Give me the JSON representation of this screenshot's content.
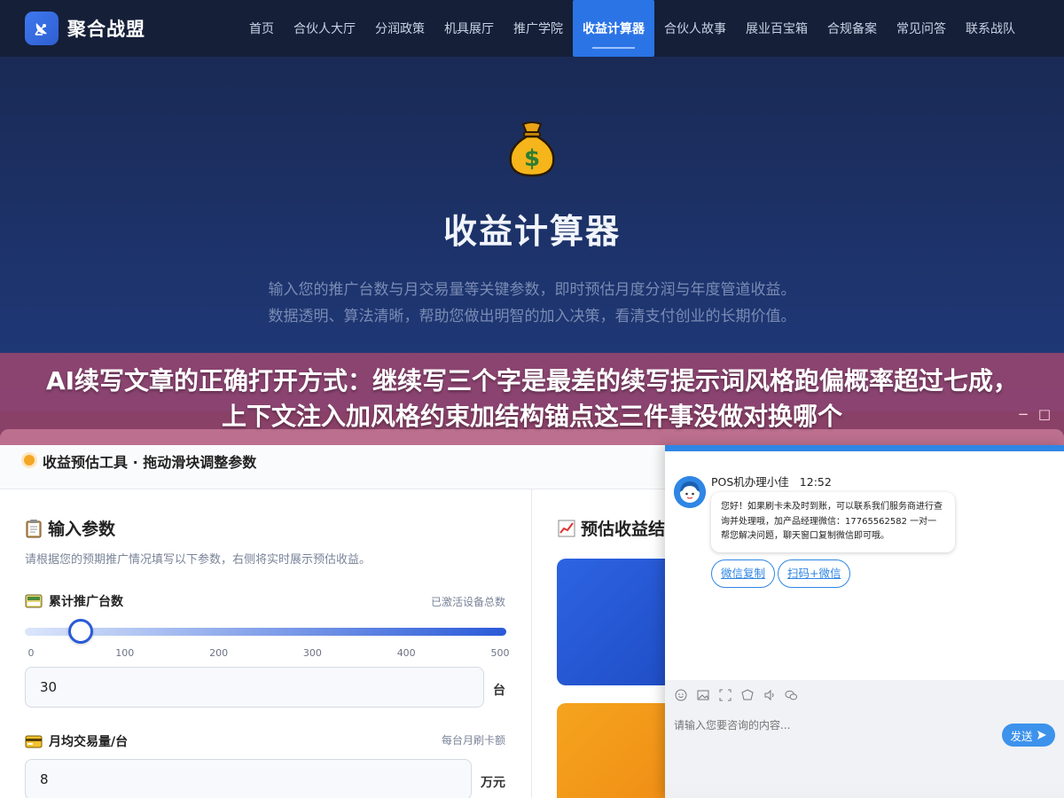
{
  "brand": {
    "name": "聚合战盟",
    "logo_icon": "satellite-dish-icon",
    "accent": "#2b74e6"
  },
  "nav": {
    "items": [
      {
        "label": "首页"
      },
      {
        "label": "合伙人大厅"
      },
      {
        "label": "分润政策"
      },
      {
        "label": "机具展厅"
      },
      {
        "label": "推广学院"
      },
      {
        "label": "收益计算器",
        "active": true
      },
      {
        "label": "合伙人故事"
      },
      {
        "label": "展业百宝箱"
      },
      {
        "label": "合规备案"
      },
      {
        "label": "常见问答"
      },
      {
        "label": "联系战队"
      }
    ]
  },
  "hero": {
    "icon": "money-bag-icon",
    "title": "收益计算器",
    "description": "输入您的推广台数与月交易量等关键参数，即时预估月度分润与年度管道收益。数据透明、算法清晰，帮助您做出明智的加入决策，看清支付创业的长期价值。"
  },
  "banner": {
    "text": "AI续写文章的正确打开方式：继续写三个字是最差的续写提示词风格跑偏概率超过七成，上下文注入加风格约束加结构锚点这三件事没做对换哪个",
    "minimize": "−",
    "maximize": "□",
    "background": "#aa486e"
  },
  "calculator": {
    "header_title": "收益预估工具 · 拖动滑块调整参数",
    "input_section": {
      "title": "输入参数",
      "icon": "clipboard-icon",
      "subtitle": "请根据您的预期推广情况填写以下参数，右侧将实时展示预估收益。",
      "devices": {
        "label": "累计推广台数",
        "icon": "pos-terminal-icon",
        "hint": "已激活设备总数",
        "value": "30",
        "slider_min": 0,
        "slider_max": 500,
        "slider_value": 30,
        "ticks": [
          "0",
          "100",
          "200",
          "300",
          "400",
          "500"
        ],
        "unit": "台"
      },
      "volume": {
        "label": "月均交易量/台",
        "icon": "credit-card-icon",
        "hint": "每台月刷卡额",
        "value": "8",
        "unit": "万元"
      }
    },
    "result_section": {
      "title": "预估收益结",
      "icon": "chart-up-icon"
    }
  },
  "chat": {
    "agent_name": "POS机办理小佳",
    "time": "12:52",
    "message": "您好！如果刷卡未及时到账，可以联系我们服务商进行查询并处理哦，加产品经理微信：17765562582 一对一帮您解决问题，聊天窗口复制微信即可哦。",
    "chips": [
      "微信复制",
      "扫码+微信"
    ],
    "toolbar_icons": [
      "emoji-icon",
      "image-icon",
      "screenshot-icon",
      "rating-icon",
      "voice-icon",
      "wechat-icon"
    ],
    "input_placeholder": "请输入您要咨询的内容...",
    "send_label": "发送",
    "accent": "#2f86e4"
  }
}
